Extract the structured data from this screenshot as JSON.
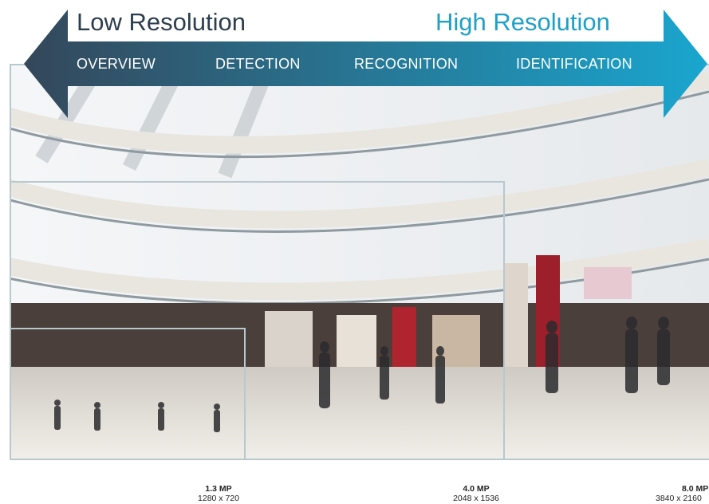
{
  "header": {
    "low_label": "Low Resolution",
    "high_label": "High Resolution",
    "stages": [
      "OVERVIEW",
      "DETECTION",
      "RECOGNITION",
      "IDENTIFICATION"
    ]
  },
  "resolutions": [
    {
      "mp": "1.3 MP",
      "pixels": "1280 x 720"
    },
    {
      "mp": "4.0 MP",
      "pixels": "2048 x 1536"
    },
    {
      "mp": "8.0 MP",
      "pixels": "3840 x 2160"
    }
  ],
  "colors": {
    "arrow_dark": "#34475a",
    "arrow_light": "#1aa6cf",
    "frame": "#b8c8cf"
  }
}
